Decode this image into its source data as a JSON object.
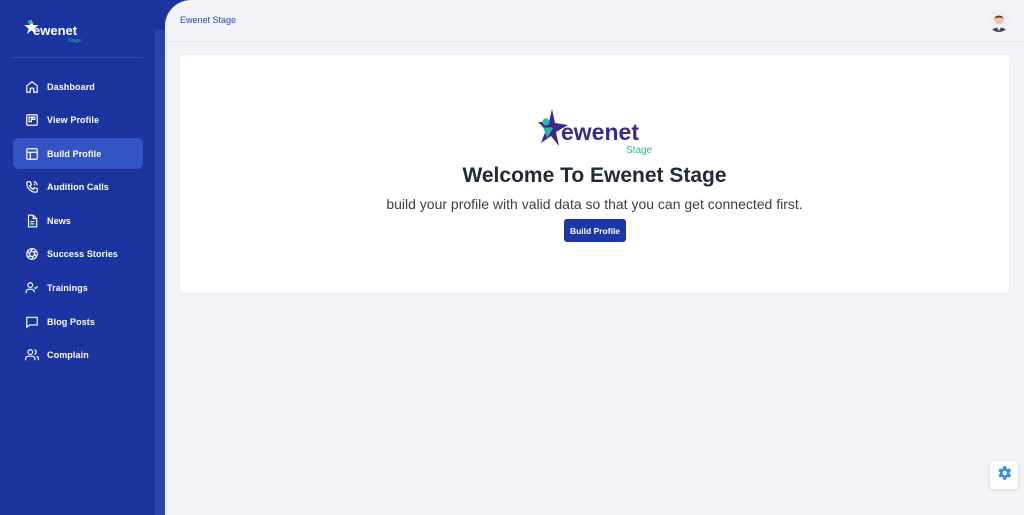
{
  "app": {
    "brand_main": "ewenet",
    "brand_sub": "Stage"
  },
  "sidebar": {
    "items": [
      {
        "label": "Dashboard",
        "icon": "home-icon",
        "active": false
      },
      {
        "label": "View Profile",
        "icon": "profile-card-icon",
        "active": false
      },
      {
        "label": "Build Profile",
        "icon": "layout-icon",
        "active": true
      },
      {
        "label": "Audition Calls",
        "icon": "phone-icon",
        "active": false
      },
      {
        "label": "News",
        "icon": "document-icon",
        "active": false
      },
      {
        "label": "Success Stories",
        "icon": "aperture-icon",
        "active": false
      },
      {
        "label": "Trainings",
        "icon": "user-check-icon",
        "active": false
      },
      {
        "label": "Blog Posts",
        "icon": "chat-icon",
        "active": false
      },
      {
        "label": "Complain",
        "icon": "users-icon",
        "active": false
      }
    ]
  },
  "header": {
    "breadcrumb": "Ewenet Stage"
  },
  "welcome": {
    "title": "Welcome To Ewenet Stage",
    "subtitle": "build your profile with valid data so that you can get connected first.",
    "button_label": "Build Profile"
  },
  "colors": {
    "sidebar": "#1c34a0",
    "active_item": "#3554c4",
    "primary_button": "#1c38a5",
    "logo_purple": "#3a2a8c",
    "logo_teal": "#2bb8a6",
    "settings_blue": "#3b8ee6"
  }
}
